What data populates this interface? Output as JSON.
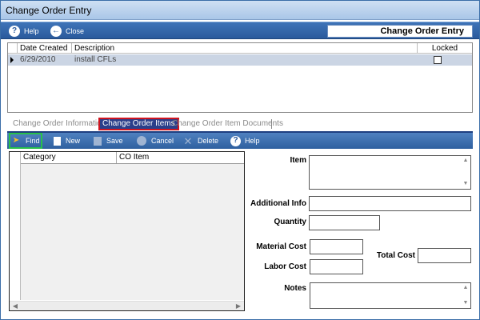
{
  "window": {
    "title": "Change Order Entry"
  },
  "toolbar": {
    "help_label": "Help",
    "close_label": "Close",
    "header_title": "Change Order Entry"
  },
  "grid": {
    "columns": [
      "Date Created",
      "Description",
      "Locked"
    ],
    "rows": [
      {
        "date_created": "6/29/2010",
        "description": "install CFLs",
        "locked": false
      }
    ]
  },
  "tabs": [
    {
      "label": "Change Order Information",
      "active": false
    },
    {
      "label": "Change Order Items",
      "active": true
    },
    {
      "label": "Change Order Item Documents",
      "active": false
    }
  ],
  "item_toolbar": {
    "find_label": "Find",
    "new_label": "New",
    "save_label": "Save",
    "cancel_label": "Cancel",
    "delete_label": "Delete",
    "help_label": "Help"
  },
  "item_list": {
    "columns": [
      "Category",
      "CO Item"
    ]
  },
  "form": {
    "item_label": "Item",
    "item_value": "",
    "additional_info_label": "Additional Info",
    "additional_info_value": "",
    "quantity_label": "Quantity",
    "quantity_value": "",
    "material_cost_label": "Material Cost",
    "material_cost_value": "",
    "total_cost_label": "Total Cost",
    "total_cost_value": "",
    "labor_cost_label": "Labor Cost",
    "labor_cost_value": "",
    "notes_label": "Notes",
    "notes_value": ""
  }
}
